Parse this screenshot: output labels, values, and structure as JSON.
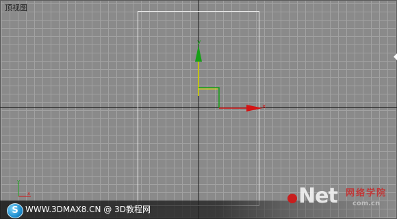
{
  "viewport": {
    "label": "顶视图",
    "background_color": "#8a8a8a",
    "grid_color": "#a2a2a2",
    "axis_line_color": "#1a1a1a",
    "plane_outline_color": "#f4f4f4"
  },
  "gizmo": {
    "x_label": "x",
    "y_label": "y",
    "x_color": "#d41414",
    "y_color": "#16a016",
    "plane_handle_color": "#e8e800"
  },
  "corner_axis": {
    "x_label": "x",
    "y_label": "y"
  },
  "footer": {
    "logo_letter": "S",
    "site_text": "WWW.3DMAX8.CN @ 3D教程网"
  },
  "watermark": {
    "brand": "Net",
    "chinese": "网络学院",
    "url": "com.cn"
  }
}
